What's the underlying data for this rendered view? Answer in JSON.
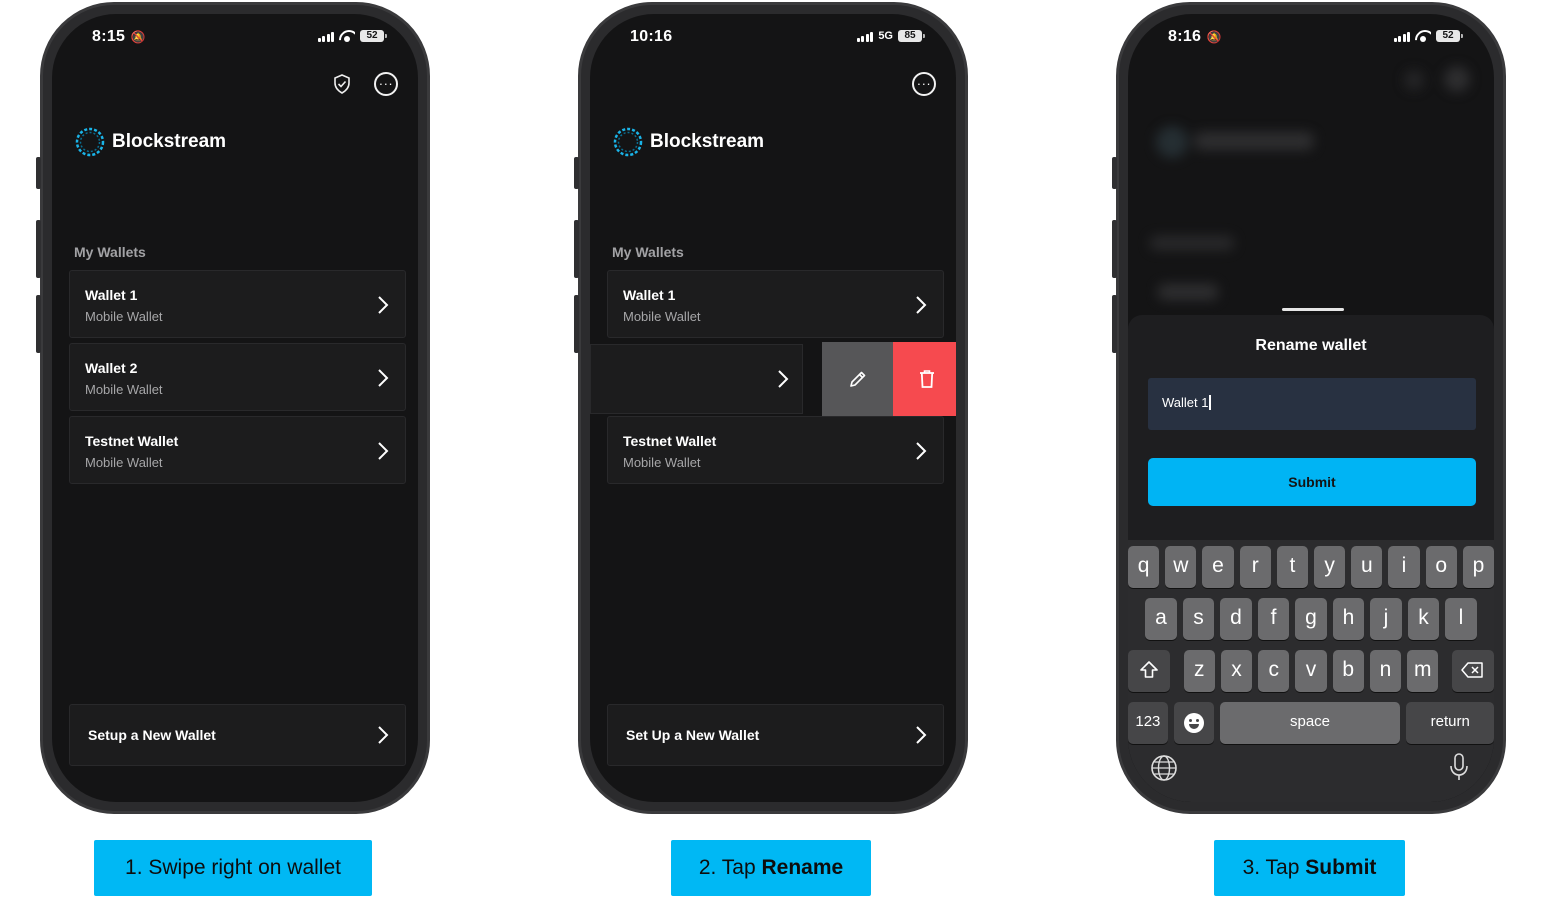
{
  "phone1": {
    "status": {
      "time": "8:15",
      "battery": "52"
    },
    "brand": "Blockstream",
    "section_title": "My Wallets",
    "wallets": [
      {
        "name": "Wallet 1",
        "type": "Mobile Wallet"
      },
      {
        "name": "Wallet 2",
        "type": "Mobile Wallet"
      },
      {
        "name": "Testnet Wallet",
        "type": "Mobile Wallet"
      }
    ],
    "setup_label": "Setup a New Wallet",
    "icons": [
      "shield-check-icon",
      "more-options-icon"
    ]
  },
  "phone2": {
    "status": {
      "time": "10:16",
      "network": "5G",
      "battery": "85"
    },
    "brand": "Blockstream",
    "section_title": "My Wallets",
    "wallets": [
      {
        "name": "Wallet 1",
        "type": "Mobile Wallet"
      },
      {
        "name": "Testnet Wallet",
        "type": "Mobile Wallet"
      }
    ],
    "swipe_actions": [
      "pencil-icon",
      "trash-icon"
    ],
    "setup_label": "Set Up a New Wallet"
  },
  "phone3": {
    "status": {
      "time": "8:16",
      "battery": "52"
    },
    "sheet_title": "Rename wallet",
    "input_value": "Wallet 1",
    "submit_label": "Submit",
    "keyboard": {
      "row1": [
        "q",
        "w",
        "e",
        "r",
        "t",
        "y",
        "u",
        "i",
        "o",
        "p"
      ],
      "row2": [
        "a",
        "s",
        "d",
        "f",
        "g",
        "h",
        "j",
        "k",
        "l"
      ],
      "row3": [
        "z",
        "x",
        "c",
        "v",
        "b",
        "n",
        "m"
      ],
      "numbers_label": "123",
      "space_label": "space",
      "return_label": "return"
    }
  },
  "captions": [
    {
      "prefix": "1. Swipe right on wallet",
      "bold": ""
    },
    {
      "prefix": "2. Tap ",
      "bold": "Rename"
    },
    {
      "prefix": "3. Tap ",
      "bold": "Submit"
    }
  ],
  "colors": {
    "accent": "#00b8f4",
    "delete": "#f64a4f",
    "background": "#141415"
  }
}
